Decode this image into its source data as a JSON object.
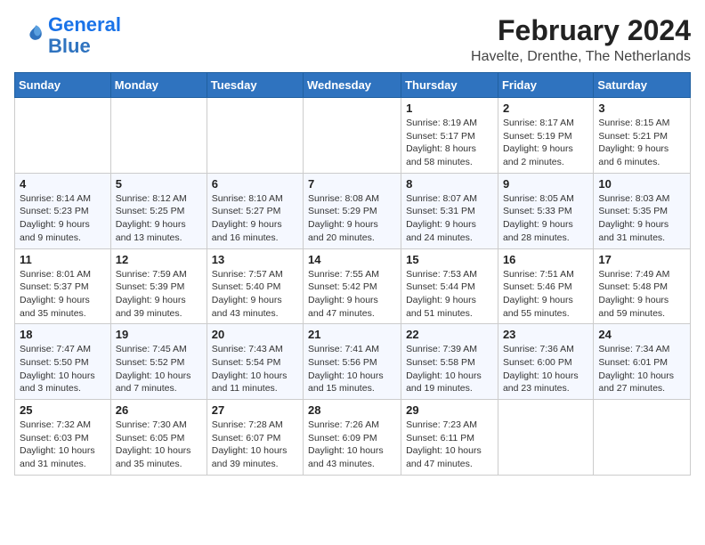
{
  "header": {
    "logo_line1": "General",
    "logo_line2": "Blue",
    "month_year": "February 2024",
    "location": "Havelte, Drenthe, The Netherlands"
  },
  "weekdays": [
    "Sunday",
    "Monday",
    "Tuesday",
    "Wednesday",
    "Thursday",
    "Friday",
    "Saturday"
  ],
  "weeks": [
    [
      {
        "day": "",
        "info": ""
      },
      {
        "day": "",
        "info": ""
      },
      {
        "day": "",
        "info": ""
      },
      {
        "day": "",
        "info": ""
      },
      {
        "day": "1",
        "info": "Sunrise: 8:19 AM\nSunset: 5:17 PM\nDaylight: 8 hours\nand 58 minutes."
      },
      {
        "day": "2",
        "info": "Sunrise: 8:17 AM\nSunset: 5:19 PM\nDaylight: 9 hours\nand 2 minutes."
      },
      {
        "day": "3",
        "info": "Sunrise: 8:15 AM\nSunset: 5:21 PM\nDaylight: 9 hours\nand 6 minutes."
      }
    ],
    [
      {
        "day": "4",
        "info": "Sunrise: 8:14 AM\nSunset: 5:23 PM\nDaylight: 9 hours\nand 9 minutes."
      },
      {
        "day": "5",
        "info": "Sunrise: 8:12 AM\nSunset: 5:25 PM\nDaylight: 9 hours\nand 13 minutes."
      },
      {
        "day": "6",
        "info": "Sunrise: 8:10 AM\nSunset: 5:27 PM\nDaylight: 9 hours\nand 16 minutes."
      },
      {
        "day": "7",
        "info": "Sunrise: 8:08 AM\nSunset: 5:29 PM\nDaylight: 9 hours\nand 20 minutes."
      },
      {
        "day": "8",
        "info": "Sunrise: 8:07 AM\nSunset: 5:31 PM\nDaylight: 9 hours\nand 24 minutes."
      },
      {
        "day": "9",
        "info": "Sunrise: 8:05 AM\nSunset: 5:33 PM\nDaylight: 9 hours\nand 28 minutes."
      },
      {
        "day": "10",
        "info": "Sunrise: 8:03 AM\nSunset: 5:35 PM\nDaylight: 9 hours\nand 31 minutes."
      }
    ],
    [
      {
        "day": "11",
        "info": "Sunrise: 8:01 AM\nSunset: 5:37 PM\nDaylight: 9 hours\nand 35 minutes."
      },
      {
        "day": "12",
        "info": "Sunrise: 7:59 AM\nSunset: 5:39 PM\nDaylight: 9 hours\nand 39 minutes."
      },
      {
        "day": "13",
        "info": "Sunrise: 7:57 AM\nSunset: 5:40 PM\nDaylight: 9 hours\nand 43 minutes."
      },
      {
        "day": "14",
        "info": "Sunrise: 7:55 AM\nSunset: 5:42 PM\nDaylight: 9 hours\nand 47 minutes."
      },
      {
        "day": "15",
        "info": "Sunrise: 7:53 AM\nSunset: 5:44 PM\nDaylight: 9 hours\nand 51 minutes."
      },
      {
        "day": "16",
        "info": "Sunrise: 7:51 AM\nSunset: 5:46 PM\nDaylight: 9 hours\nand 55 minutes."
      },
      {
        "day": "17",
        "info": "Sunrise: 7:49 AM\nSunset: 5:48 PM\nDaylight: 9 hours\nand 59 minutes."
      }
    ],
    [
      {
        "day": "18",
        "info": "Sunrise: 7:47 AM\nSunset: 5:50 PM\nDaylight: 10 hours\nand 3 minutes."
      },
      {
        "day": "19",
        "info": "Sunrise: 7:45 AM\nSunset: 5:52 PM\nDaylight: 10 hours\nand 7 minutes."
      },
      {
        "day": "20",
        "info": "Sunrise: 7:43 AM\nSunset: 5:54 PM\nDaylight: 10 hours\nand 11 minutes."
      },
      {
        "day": "21",
        "info": "Sunrise: 7:41 AM\nSunset: 5:56 PM\nDaylight: 10 hours\nand 15 minutes."
      },
      {
        "day": "22",
        "info": "Sunrise: 7:39 AM\nSunset: 5:58 PM\nDaylight: 10 hours\nand 19 minutes."
      },
      {
        "day": "23",
        "info": "Sunrise: 7:36 AM\nSunset: 6:00 PM\nDaylight: 10 hours\nand 23 minutes."
      },
      {
        "day": "24",
        "info": "Sunrise: 7:34 AM\nSunset: 6:01 PM\nDaylight: 10 hours\nand 27 minutes."
      }
    ],
    [
      {
        "day": "25",
        "info": "Sunrise: 7:32 AM\nSunset: 6:03 PM\nDaylight: 10 hours\nand 31 minutes."
      },
      {
        "day": "26",
        "info": "Sunrise: 7:30 AM\nSunset: 6:05 PM\nDaylight: 10 hours\nand 35 minutes."
      },
      {
        "day": "27",
        "info": "Sunrise: 7:28 AM\nSunset: 6:07 PM\nDaylight: 10 hours\nand 39 minutes."
      },
      {
        "day": "28",
        "info": "Sunrise: 7:26 AM\nSunset: 6:09 PM\nDaylight: 10 hours\nand 43 minutes."
      },
      {
        "day": "29",
        "info": "Sunrise: 7:23 AM\nSunset: 6:11 PM\nDaylight: 10 hours\nand 47 minutes."
      },
      {
        "day": "",
        "info": ""
      },
      {
        "day": "",
        "info": ""
      }
    ]
  ]
}
